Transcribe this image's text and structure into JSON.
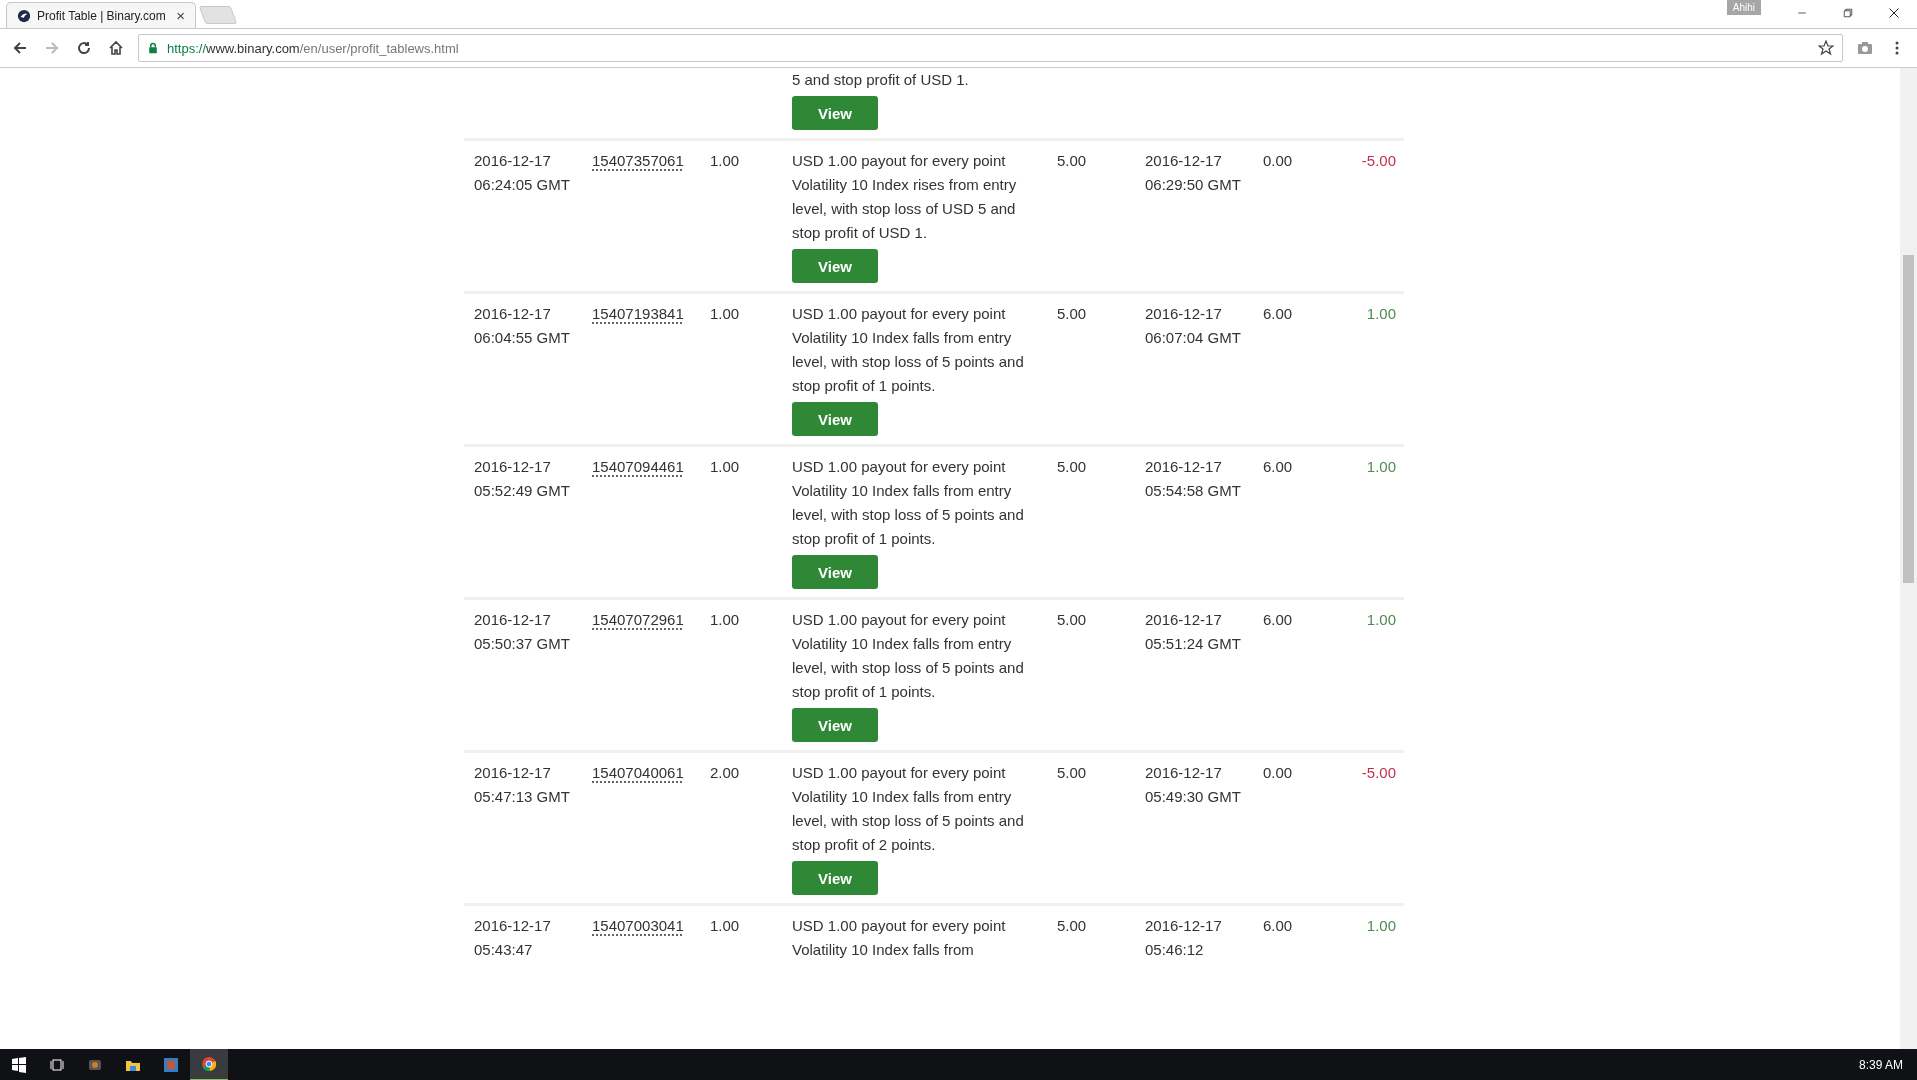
{
  "browser": {
    "tab_title": "Profit Table | Binary.com",
    "tab_close": "×",
    "profile": "Ahihi",
    "url_scheme": "https://",
    "url_host": "www.binary.com",
    "url_path": "/en/user/profit_tablews.html"
  },
  "table": {
    "partial_row": {
      "column_4": "5 and stop profit of USD 1.",
      "button": "View"
    },
    "rows": [
      {
        "column_1": "2016-12-17 06:24:05 GMT",
        "column_2": "15407357061",
        "column_3": "1.00",
        "column_4": "USD 1.00 payout for every point Volatility 10 Index rises from entry level, with stop loss of USD 5 and stop profit of USD 1.",
        "button": "View",
        "column_5": "5.00",
        "column_6": "2016-12-17 06:29:50 GMT",
        "column_7": "0.00",
        "column_8": "-5.00",
        "color": "#c0314f"
      },
      {
        "column_1": "2016-12-17 06:04:55 GMT",
        "column_2": "15407193841",
        "column_3": "1.00",
        "column_4": "USD 1.00 payout for every point Volatility 10 Index falls from entry level, with stop loss of 5 points and stop profit of 1 points.",
        "button": "View",
        "column_5": "5.00",
        "column_6": "2016-12-17 06:07:04 GMT",
        "column_7": "6.00",
        "column_8": "1.00",
        "color": "#4f8a4f"
      },
      {
        "column_1": "2016-12-17 05:52:49 GMT",
        "column_2": "15407094461",
        "column_3": "1.00",
        "column_4": "USD 1.00 payout for every point Volatility 10 Index falls from entry level, with stop loss of 5 points and stop profit of 1 points.",
        "button": "View",
        "column_5": "5.00",
        "column_6": "2016-12-17 05:54:58 GMT",
        "column_7": "6.00",
        "column_8": "1.00",
        "color": "#4f8a4f"
      },
      {
        "column_1": "2016-12-17 05:50:37 GMT",
        "column_2": "15407072961",
        "column_3": "1.00",
        "column_4": "USD 1.00 payout for every point Volatility 10 Index falls from entry level, with stop loss of 5 points and stop profit of 1 points.",
        "button": "View",
        "column_5": "5.00",
        "column_6": "2016-12-17 05:51:24 GMT",
        "column_7": "6.00",
        "column_8": "1.00",
        "color": "#4f8a4f"
      },
      {
        "column_1": "2016-12-17 05:47:13 GMT",
        "column_2": "15407040061",
        "column_3": "2.00",
        "column_4": "USD 1.00 payout for every point Volatility 10 Index falls from entry level, with stop loss of 5 points and stop profit of 2 points.",
        "button": "View",
        "column_5": "5.00",
        "column_6": "2016-12-17 05:49:30 GMT",
        "column_7": "0.00",
        "column_8": "-5.00",
        "color": "#c0314f"
      },
      {
        "column_1": "2016-12-17 05:43:47",
        "column_2": "15407003041",
        "column_3": "1.00",
        "column_4": "USD 1.00 payout for every point Volatility 10 Index falls from",
        "column_5": "5.00",
        "column_6": "2016-12-17 05:46:12",
        "column_7": "6.00",
        "column_8": "1.00",
        "color": "#4f8a4f"
      }
    ]
  },
  "taskbar": {
    "clock": "8:39 AM"
  }
}
